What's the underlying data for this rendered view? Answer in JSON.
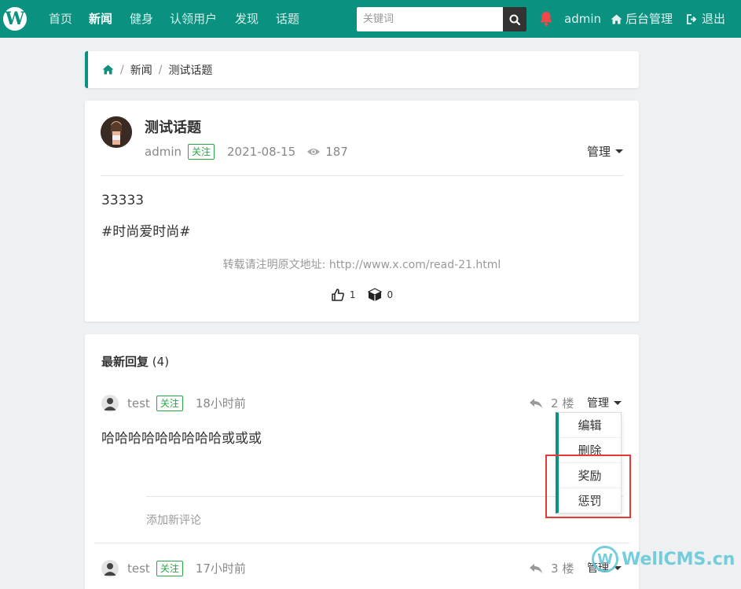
{
  "nav": {
    "logo_letter": "W",
    "items": [
      "首页",
      "新闻",
      "健身",
      "认领用户",
      "发现",
      "话题"
    ],
    "active_index": 1,
    "search_placeholder": "关键词",
    "user": "admin",
    "admin_link": "后台管理",
    "logout": "退出"
  },
  "breadcrumb": [
    "新闻",
    "测试话题"
  ],
  "post": {
    "title": "测试话题",
    "author": "admin",
    "follow_label": "关注",
    "date": "2021-08-15",
    "views": "187",
    "manage_label": "管理",
    "content": [
      "33333",
      "#时尚爱时尚#"
    ],
    "source_note": "转载请注明原文地址: http://www.x.com/read-21.html",
    "likes": "1",
    "favorites": "0"
  },
  "replies": {
    "heading": "最新回复",
    "count": "(4)",
    "items": [
      {
        "user": "test",
        "follow_label": "关注",
        "time": "18小时前",
        "floor": "2",
        "floor_unit": "楼",
        "manage_label": "管理",
        "text": "哈哈哈哈哈哈哈哈哈或或或"
      },
      {
        "user": "test",
        "follow_label": "关注",
        "time": "17小时前",
        "floor": "3",
        "floor_unit": "楼",
        "manage_label": "管理"
      }
    ],
    "add_comment": "添加新评论"
  },
  "dropdown": {
    "items": [
      "编辑",
      "删除",
      "奖励",
      "惩罚"
    ]
  },
  "watermark": "WellCMS.cn",
  "colors": {
    "brand": "#0a9180",
    "follow": "#28a745",
    "highlight": "#e53935"
  }
}
